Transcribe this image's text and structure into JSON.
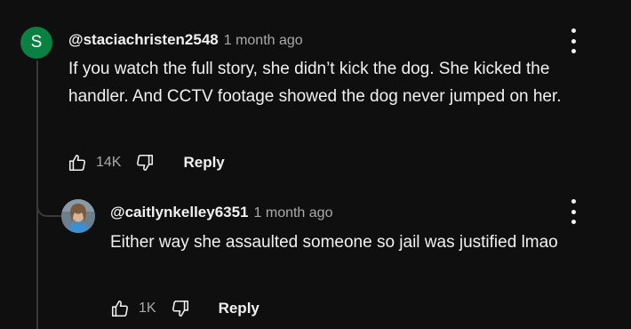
{
  "comment": {
    "avatar_letter": "S",
    "avatar_color": "#0b8043",
    "handle": "@staciachristen2548",
    "time": "1 month ago",
    "text": "If you watch the full story, she didn’t kick the dog. She kicked the handler. And CCTV footage showed the dog never jumped on her.",
    "likes": "14K",
    "reply_label": "Reply"
  },
  "reply": {
    "handle": "@caitlynkelley6351",
    "time": "1 month ago",
    "text": "Either way she assaulted someone so jail was justified lmao",
    "likes": "1K",
    "reply_label": "Reply"
  },
  "icons": {
    "like": "thumbs-up-icon",
    "dislike": "thumbs-down-icon",
    "menu": "more-vert-icon"
  }
}
